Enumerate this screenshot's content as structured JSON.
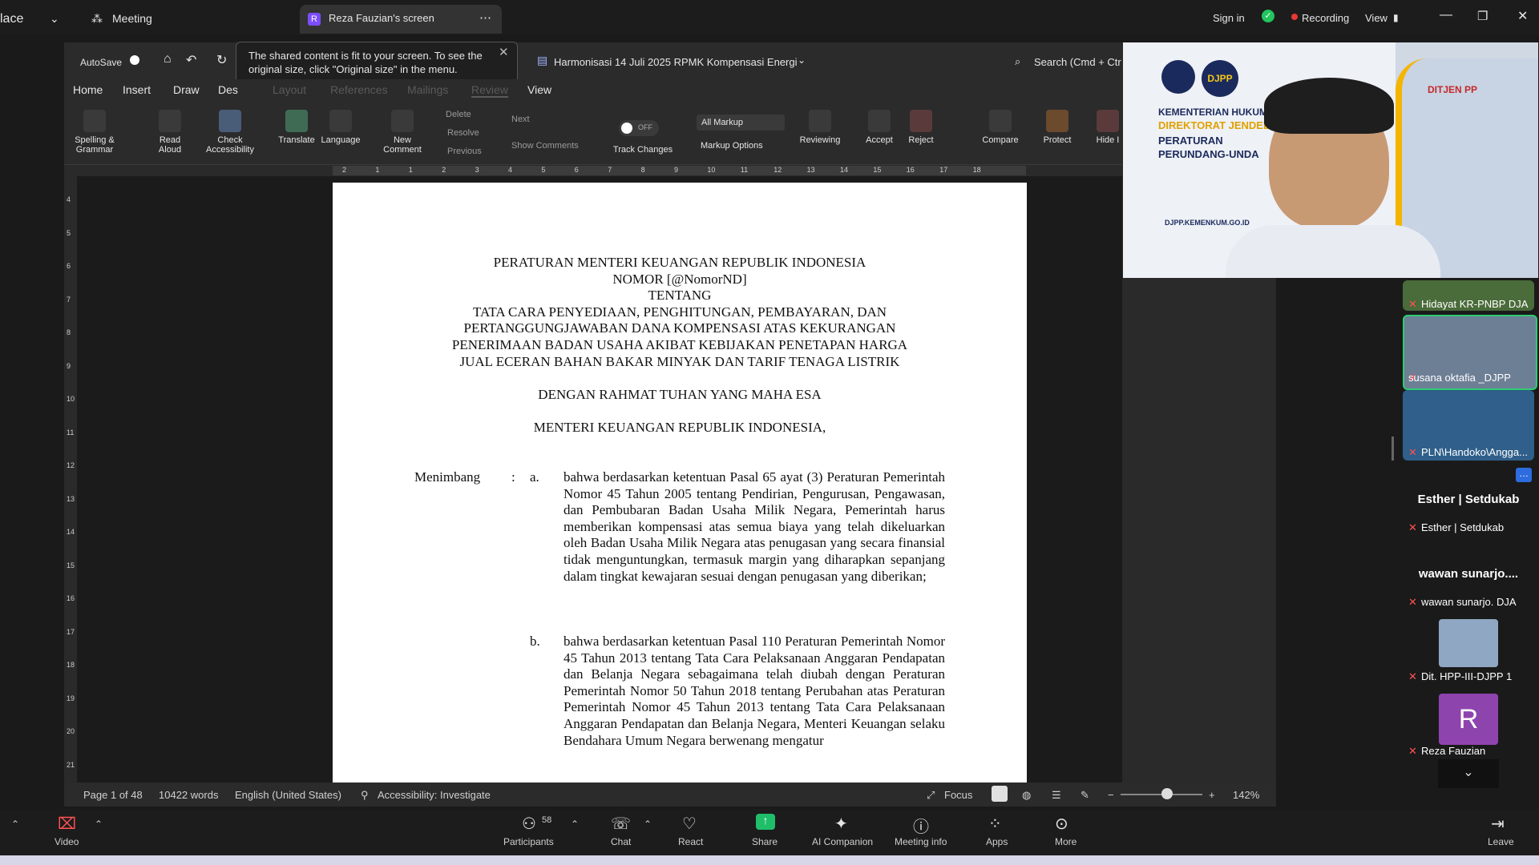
{
  "zoom_top": {
    "app_fragment": "lace",
    "meeting_label": "Meeting",
    "share_tab_avatar": "R",
    "share_tab_label": "Reza Fauzian's screen",
    "sign_in": "Sign in",
    "recording": "Recording",
    "view": "View"
  },
  "tooltip": {
    "text": "The shared content is fit to your screen. To see the original size, click \"Original size\" in the menu."
  },
  "word": {
    "autosave": "AutoSave",
    "doc_title": "Harmonisasi 14 Juli 2025 RPMK Kompensasi Energi",
    "search": "Search (Cmd + Ctr",
    "tabs": [
      "Home",
      "Insert",
      "Draw",
      "Des",
      "Layout",
      "References",
      "Mailings",
      "Review",
      "View"
    ],
    "ribbon": {
      "spelling": "Spelling &\nGrammar",
      "read_aloud": "Read\nAloud",
      "check_accessibility": "Check\nAccessibility",
      "translate": "Translate",
      "language": "Language",
      "new_comment": "New\nComment",
      "delete": "Delete",
      "resolve": "Resolve",
      "previous": "Previous",
      "next": "Next",
      "show_comments": "Show Comments",
      "track_toggle": "OFF",
      "track_changes": "Track Changes",
      "all_markup": "All Markup",
      "markup_options": "Markup Options",
      "reviewing": "Reviewing",
      "accept": "Accept",
      "reject": "Reject",
      "compare": "Compare",
      "protect": "Protect",
      "hide": "Hide I"
    },
    "ruler_numbers": [
      "2",
      "1",
      "1",
      "2",
      "3",
      "4",
      "5",
      "6",
      "7",
      "8",
      "9",
      "10",
      "11",
      "12",
      "13",
      "14",
      "15",
      "16",
      "17",
      "18"
    ],
    "vruler_numbers": [
      "4",
      "5",
      "6",
      "7",
      "8",
      "9",
      "10",
      "11",
      "12",
      "13",
      "14",
      "15",
      "16",
      "17",
      "18",
      "19",
      "20",
      "21"
    ]
  },
  "document": {
    "title_lines": [
      "PERATURAN MENTERI KEUANGAN REPUBLIK INDONESIA",
      "NOMOR [@NomorND]",
      "TENTANG",
      "TATA CARA PENYEDIAAN, PENGHITUNGAN, PEMBAYARAN, DAN",
      "PERTANGGUNGJAWABAN DANA KOMPENSASI ATAS KEKURANGAN",
      "PENERIMAAN BADAN USAHA AKIBAT KEBIJAKAN PENETAPAN HARGA",
      "JUAL ECERAN BAHAN BAKAR MINYAK DAN TARIF TENAGA LISTRIK"
    ],
    "grace": "DENGAN RAHMAT TUHAN YANG MAHA ESA",
    "minister": "MENTERI KEUANGAN REPUBLIK INDONESIA,",
    "menimbang": "Menimbang",
    "colon": ":",
    "item_a_label": "a.",
    "item_a": "bahwa berdasarkan ketentuan Pasal 65 ayat (3) Peraturan Pemerintah Nomor 45 Tahun 2005 tentang Pendirian, Pengurusan, Pengawasan, dan Pembubaran Badan Usaha Milik Negara, Pemerintah harus memberikan kompensasi atas semua biaya yang telah dikeluarkan oleh Badan Usaha Milik Negara atas penugasan yang secara finansial tidak menguntungkan, termasuk margin yang diharapkan sepanjang dalam tingkat kewajaran sesuai dengan penugasan yang diberikan;",
    "item_b_label": "b.",
    "item_b": "bahwa berdasarkan ketentuan Pasal 110 Peraturan Pemerintah Nomor 45 Tahun 2013 tentang Tata Cara Pelaksanaan Anggaran Pendapatan dan Belanja Negara sebagaimana telah diubah dengan Peraturan Pemerintah Nomor 50 Tahun 2018 tentang Perubahan atas Peraturan Pemerintah Nomor 45 Tahun 2013 tentang Tata Cara Pelaksanaan Anggaran Pendapatan dan Belanja Negara, Menteri Keuangan selaku Bendahara Umum Negara berwenang mengatur"
  },
  "status_bar": {
    "page": "Page 1 of 48",
    "words": "10422 words",
    "language": "English (United States)",
    "accessibility": "Accessibility: Investigate",
    "focus": "Focus",
    "zoom": "142%"
  },
  "speaker_video": {
    "org1": "KEMENTERIAN HUKUM R",
    "org2": "DIREKTORAT JENDEL",
    "org3": "PERATURAN",
    "org4": "PERUNDANG-UNDA",
    "logo": "DJPP",
    "building_sign": "DITJEN PP",
    "url": "DJPP.KEMENKUM.GO.ID"
  },
  "participants": [
    {
      "name": "Hidayat KR-PNBP DJA"
    },
    {
      "name": "susana oktafia _DJPP"
    },
    {
      "name": "PLN\\Handoko\\Angga..."
    },
    {
      "name": "Esther | Setdukab",
      "big": "Esther | Setdukab"
    },
    {
      "name": "wawan sunarjo. DJA",
      "big": "wawan sunarjo...."
    },
    {
      "name": "Dit. HPP-III-DJPP 1"
    },
    {
      "name": "Reza Fauzian",
      "avatar": "R"
    }
  ],
  "toolbar": {
    "video": "Video",
    "participants": "Participants",
    "participants_count": "58",
    "chat": "Chat",
    "react": "React",
    "share": "Share",
    "ai": "AI Companion",
    "meeting_info": "Meeting info",
    "apps": "Apps",
    "more": "More",
    "leave": "Leave"
  },
  "colors": {
    "accent_green": "#22c55e",
    "record_red": "#e53935",
    "avatar_purple": "#7c4dff"
  }
}
